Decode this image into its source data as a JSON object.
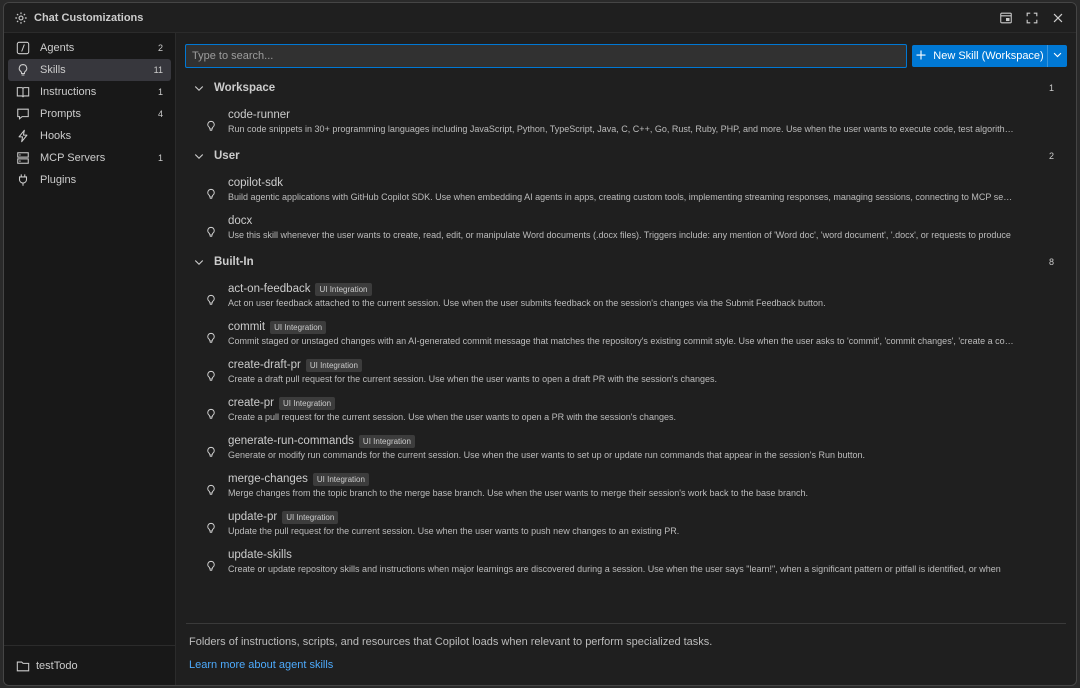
{
  "window": {
    "title": "Chat Customizations"
  },
  "sidebar": {
    "items": [
      {
        "label": "Agents",
        "count": "2",
        "icon": "agents-icon"
      },
      {
        "label": "Skills",
        "count": "11",
        "icon": "lightbulb-icon"
      },
      {
        "label": "Instructions",
        "count": "1",
        "icon": "book-icon"
      },
      {
        "label": "Prompts",
        "count": "4",
        "icon": "chat-icon"
      },
      {
        "label": "Hooks",
        "count": "",
        "icon": "lightning-icon"
      },
      {
        "label": "MCP Servers",
        "count": "1",
        "icon": "server-icon"
      },
      {
        "label": "Plugins",
        "count": "",
        "icon": "plug-icon"
      }
    ],
    "footer": {
      "label": "testTodo"
    }
  },
  "toolbar": {
    "search_placeholder": "Type to search...",
    "new_skill_label": "New Skill (Workspace)"
  },
  "sections": [
    {
      "title": "Workspace",
      "count": "1",
      "skills": [
        {
          "name": "code-runner",
          "badge": "",
          "desc": "Run code snippets in 30+ programming languages including JavaScript, Python, TypeScript, Java, C, C++, Go, Rust, Ruby, PHP, and more. Use when the user wants to execute code, test algorithms"
        }
      ]
    },
    {
      "title": "User",
      "count": "2",
      "skills": [
        {
          "name": "copilot-sdk",
          "badge": "",
          "desc": "Build agentic applications with GitHub Copilot SDK. Use when embedding AI agents in apps, creating custom tools, implementing streaming responses, managing sessions, connecting to MCP servers"
        },
        {
          "name": "docx",
          "badge": "",
          "desc": "Use this skill whenever the user wants to create, read, edit, or manipulate Word documents (.docx files). Triggers include: any mention of 'Word doc', 'word document', '.docx', or requests to produce"
        }
      ]
    },
    {
      "title": "Built-In",
      "count": "8",
      "skills": [
        {
          "name": "act-on-feedback",
          "badge": "UI Integration",
          "desc": "Act on user feedback attached to the current session. Use when the user submits feedback on the session's changes via the Submit Feedback button."
        },
        {
          "name": "commit",
          "badge": "UI Integration",
          "desc": "Commit staged or unstaged changes with an AI-generated commit message that matches the repository's existing commit style. Use when the user asks to 'commit', 'commit changes', 'create a commit'"
        },
        {
          "name": "create-draft-pr",
          "badge": "UI Integration",
          "desc": "Create a draft pull request for the current session. Use when the user wants to open a draft PR with the session's changes."
        },
        {
          "name": "create-pr",
          "badge": "UI Integration",
          "desc": "Create a pull request for the current session. Use when the user wants to open a PR with the session's changes."
        },
        {
          "name": "generate-run-commands",
          "badge": "UI Integration",
          "desc": "Generate or modify run commands for the current session. Use when the user wants to set up or update run commands that appear in the session's Run button."
        },
        {
          "name": "merge-changes",
          "badge": "UI Integration",
          "desc": "Merge changes from the topic branch to the merge base branch. Use when the user wants to merge their session's work back to the base branch."
        },
        {
          "name": "update-pr",
          "badge": "UI Integration",
          "desc": "Update the pull request for the current session. Use when the user wants to push new changes to an existing PR."
        },
        {
          "name": "update-skills",
          "badge": "",
          "desc": "Create or update repository skills and instructions when major learnings are discovered during a session. Use when the user says \"learn!\", when a significant pattern or pitfall is identified, or when"
        }
      ]
    }
  ],
  "footer": {
    "text": "Folders of instructions, scripts, and resources that Copilot loads when relevant to perform specialized tasks.",
    "link": "Learn more about agent skills"
  }
}
